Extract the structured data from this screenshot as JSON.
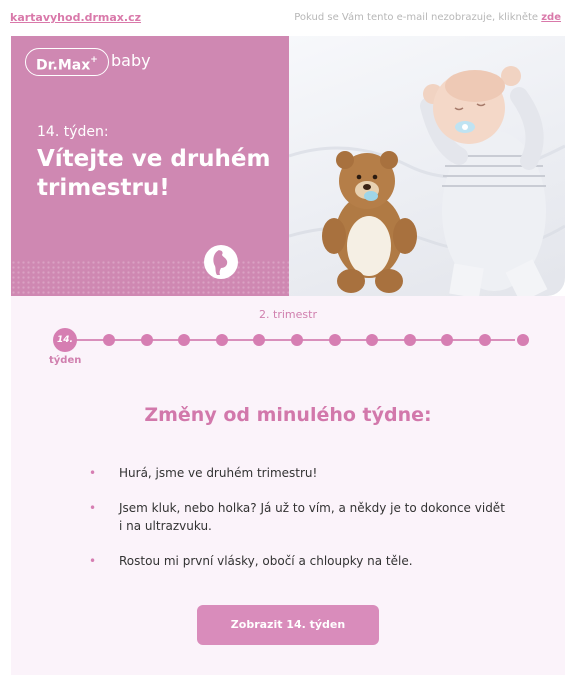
{
  "topbar": {
    "domain_link": "kartavyhod.drmax.cz",
    "notice_prefix": "Pokud se Vám tento e-mail nezobrazuje, klikněte ",
    "notice_link": "zde"
  },
  "hero": {
    "logo_text": "Dr.Max",
    "logo_plus": "+",
    "logo_suffix": "baby",
    "week_label": "14. týden:",
    "title": "Vítejte ve druhém trimestru!",
    "photo_icon": "baby-and-teddy-bear-photo"
  },
  "progress": {
    "trimester_label": "2. trimestr",
    "current_week": "14.",
    "current_caption": "týden",
    "remaining_dots": 12
  },
  "changes": {
    "heading": "Změny od minulého týdne:",
    "items": [
      "Hurá, jsme ve druhém trimestru!",
      "Jsem kluk, nebo holka? Já už to vím, a někdy je to dokonce vidět i na ultrazvuku.",
      "Rostou mi první vlásky, obočí a chloupky na těle."
    ]
  },
  "cta": {
    "label": "Zobrazit 14. týden"
  },
  "colors": {
    "accent": "#d278ab",
    "hero_pink": "#cf88b2",
    "panel_bg": "#fbf3fa"
  }
}
